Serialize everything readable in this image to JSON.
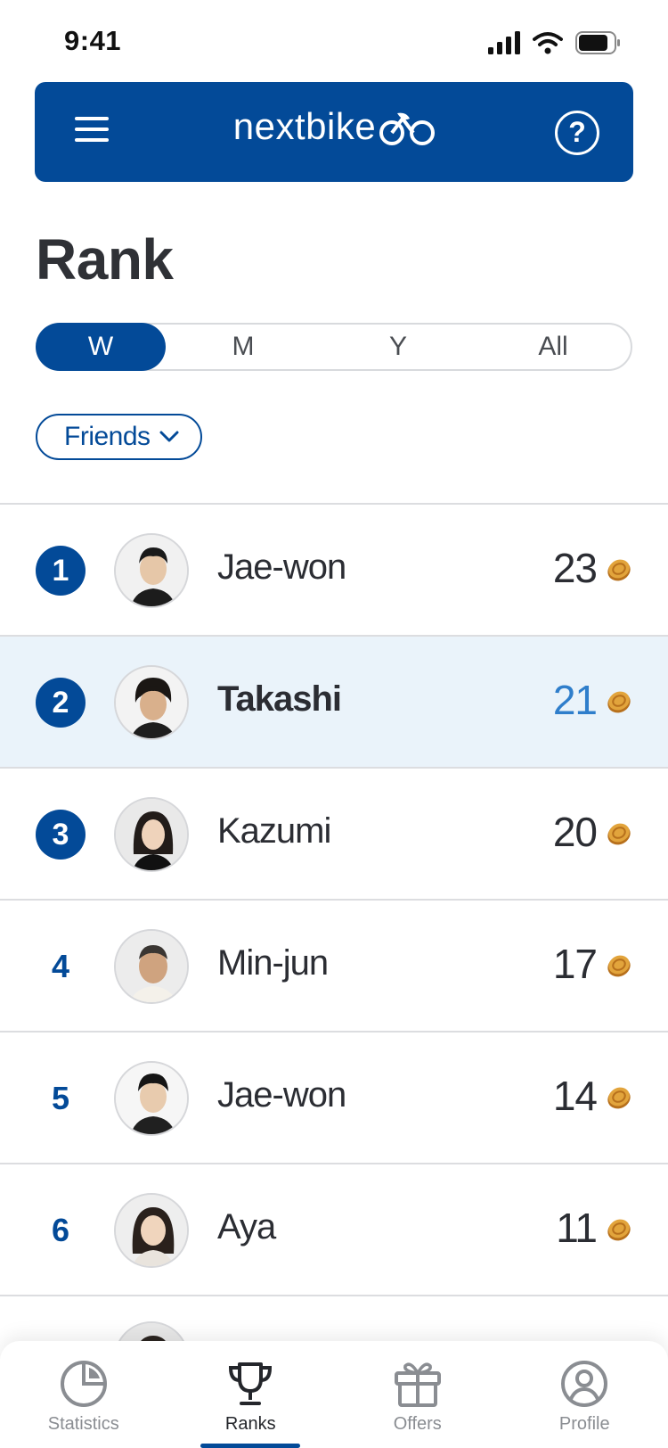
{
  "status_bar": {
    "time": "9:41"
  },
  "header": {
    "logo_text": "nextbike",
    "brand_color": "#034a98"
  },
  "page": {
    "title": "Rank"
  },
  "period_tabs": [
    {
      "label": "W",
      "active": true
    },
    {
      "label": "M",
      "active": false
    },
    {
      "label": "Y",
      "active": false
    },
    {
      "label": "All",
      "active": false
    }
  ],
  "filter": {
    "label": "Friends"
  },
  "ranking": [
    {
      "rank": "1",
      "name": "Jae-won",
      "score": "23",
      "highlight": false
    },
    {
      "rank": "2",
      "name": "Takashi",
      "score": "21",
      "highlight": true
    },
    {
      "rank": "3",
      "name": "Kazumi",
      "score": "20",
      "highlight": false
    },
    {
      "rank": "4",
      "name": "Min-jun",
      "score": "17",
      "highlight": false
    },
    {
      "rank": "5",
      "name": "Jae-won",
      "score": "14",
      "highlight": false
    },
    {
      "rank": "6",
      "name": "Aya",
      "score": "11",
      "highlight": false
    }
  ],
  "tab_bar": [
    {
      "label": "Statistics",
      "icon": "pie-chart-icon",
      "active": false
    },
    {
      "label": "Ranks",
      "icon": "trophy-icon",
      "active": true
    },
    {
      "label": "Offers",
      "icon": "gift-icon",
      "active": false
    },
    {
      "label": "Profile",
      "icon": "user-icon",
      "active": false
    }
  ]
}
